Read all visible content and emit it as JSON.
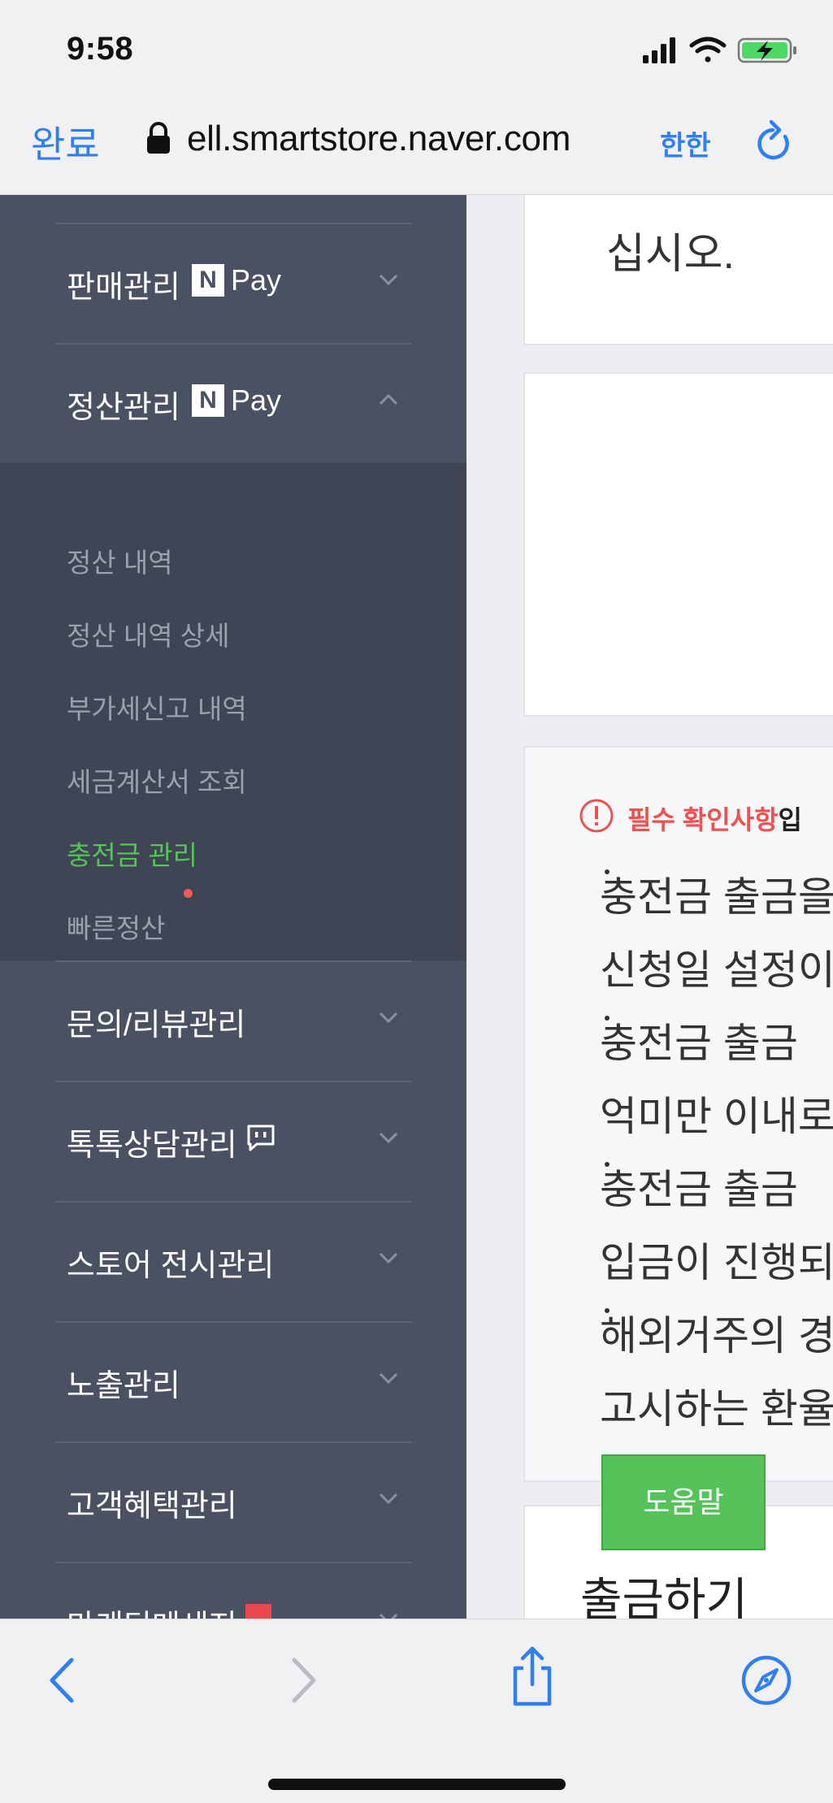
{
  "status_bar": {
    "time": "9:58"
  },
  "browser": {
    "done_label": "완료",
    "url": "ell.smartstore.naver.com",
    "reader_label": "한한"
  },
  "sidebar": {
    "items": [
      {
        "label": "판매관리",
        "pay_label": "Pay",
        "badge_letter": "N",
        "expanded": false
      },
      {
        "label": "정산관리",
        "pay_label": "Pay",
        "badge_letter": "N",
        "expanded": true
      },
      {
        "label": "문의/리뷰관리"
      },
      {
        "label": "톡톡상담관리"
      },
      {
        "label": "스토어 전시관리"
      },
      {
        "label": "노출관리"
      },
      {
        "label": "고객혜택관리"
      },
      {
        "label": "마케팅메세지"
      }
    ],
    "submenu": [
      {
        "label": "정산 내역"
      },
      {
        "label": "정산 내역 상세"
      },
      {
        "label": "부가세신고 내역"
      },
      {
        "label": "세금계산서 조회"
      },
      {
        "label": "충전금 관리",
        "active": true
      },
      {
        "label": "빠른정산",
        "has_new_dot": true
      }
    ]
  },
  "content": {
    "top_card_text": "십시오.",
    "notice": {
      "head": "필수 확인사항",
      "head_tail": "입",
      "lines": [
        "충전금 출금을",
        "신청일 설정이",
        "충전금 출금",
        "억미만 이내로",
        "충전금 출금",
        "입금이 진행되",
        "해외거주의 경",
        "고시하는 환율"
      ]
    },
    "withdraw_title": "출금하기",
    "help_button": "도움말"
  },
  "colors": {
    "sidebar_bg": "#4a5162",
    "submenu_bg": "#3f4555",
    "accent_green": "#56c35a",
    "link_blue": "#2f7ff3",
    "notice_red": "#f05050"
  }
}
